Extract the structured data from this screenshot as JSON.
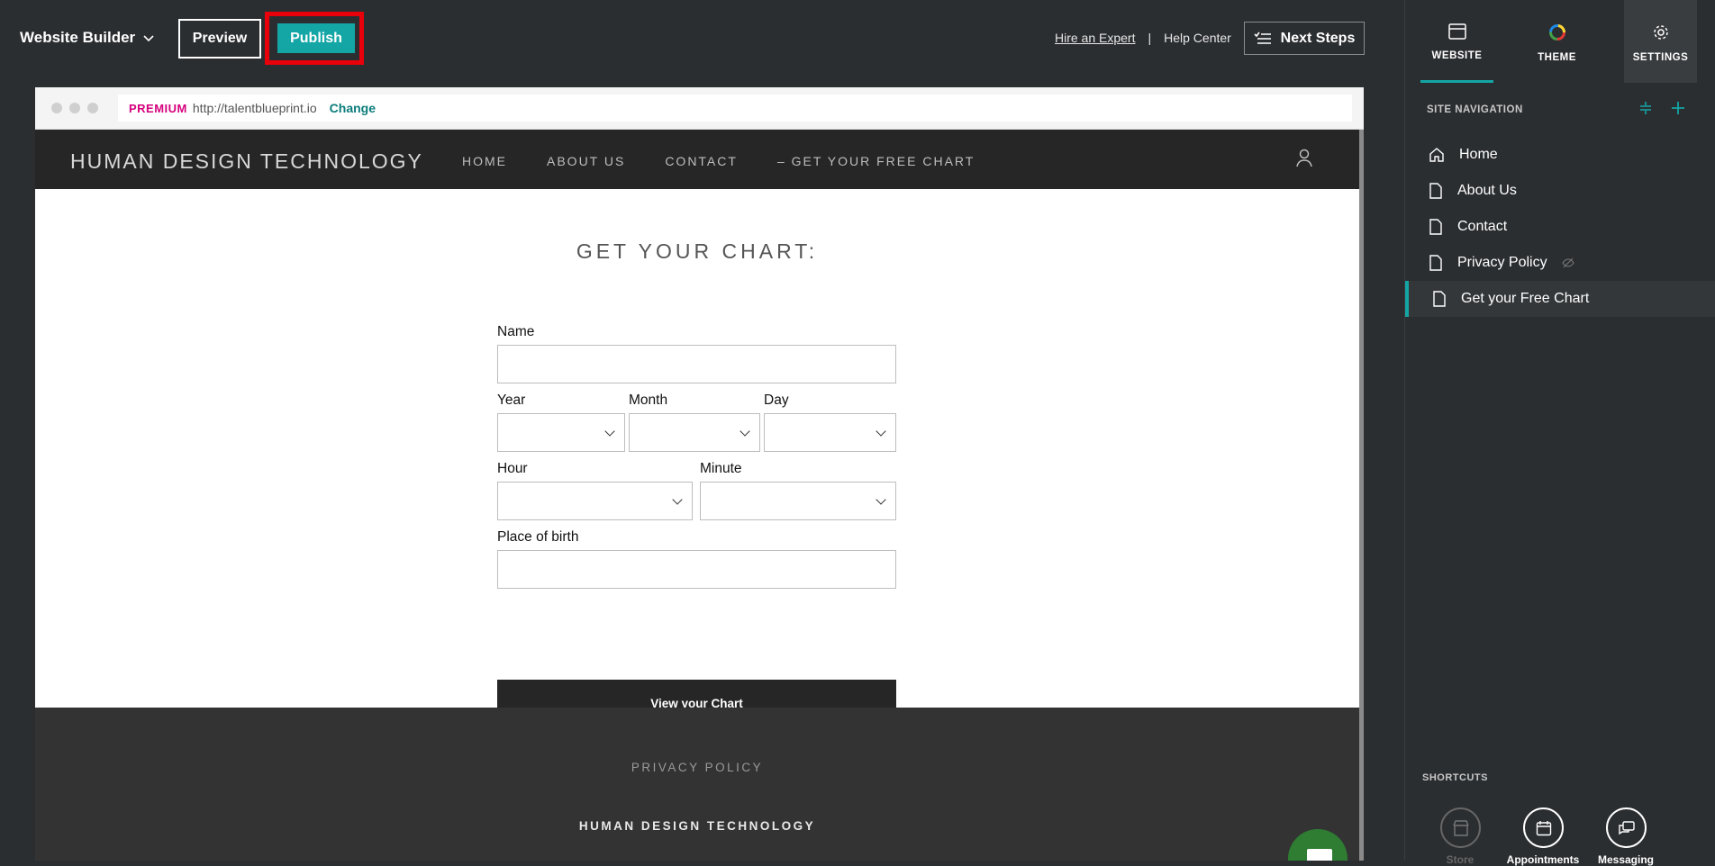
{
  "topbar": {
    "app_name": "Website Builder",
    "preview_label": "Preview",
    "publish_label": "Publish",
    "hire_expert": "Hire an Expert",
    "separator": "|",
    "help_center": "Help Center",
    "next_steps": "Next Steps"
  },
  "browser": {
    "premium": "PREMIUM",
    "url": "http://talentblueprint.io",
    "change": "Change"
  },
  "site": {
    "logo": "HUMAN DESIGN TECHNOLOGY",
    "nav": [
      "HOME",
      "ABOUT US",
      "CONTACT",
      "– GET YOUR FREE CHART"
    ]
  },
  "form": {
    "heading": "GET YOUR CHART:",
    "name_label": "Name",
    "year_label": "Year",
    "month_label": "Month",
    "day_label": "Day",
    "hour_label": "Hour",
    "minute_label": "Minute",
    "place_label": "Place of birth",
    "submit": "View your Chart"
  },
  "footer": {
    "privacy": "PRIVACY POLICY",
    "brand": "HUMAN DESIGN TECHNOLOGY"
  },
  "panel": {
    "tabs": [
      "WEBSITE",
      "THEME",
      "SETTINGS"
    ],
    "nav_heading": "SITE NAVIGATION",
    "nav_items": [
      "Home",
      "About Us",
      "Contact",
      "Privacy Policy",
      "Get your Free Chart"
    ],
    "shortcuts_heading": "SHORTCUTS",
    "shortcuts": [
      "Store",
      "Appointments",
      "Messaging"
    ]
  },
  "colors": {
    "accent": "#14a5a5",
    "highlight": "#e8000b",
    "premium": "#d6007d"
  }
}
